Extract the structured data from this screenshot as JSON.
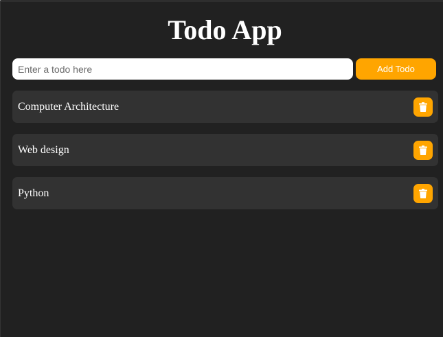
{
  "app": {
    "title": "Todo App"
  },
  "input": {
    "placeholder": "Enter a todo here",
    "value": ""
  },
  "add_button": {
    "label": "Add Todo"
  },
  "todos": [
    {
      "text": "Computer Architecture",
      "action_icon": "trash-icon"
    },
    {
      "text": "Web design",
      "action_icon": "trash-icon"
    },
    {
      "text": "Python",
      "action_icon": "trash-icon"
    }
  ],
  "colors": {
    "background": "#212121",
    "accent": "#ffa500",
    "item_background": "#323232",
    "text": "#ffffff"
  }
}
